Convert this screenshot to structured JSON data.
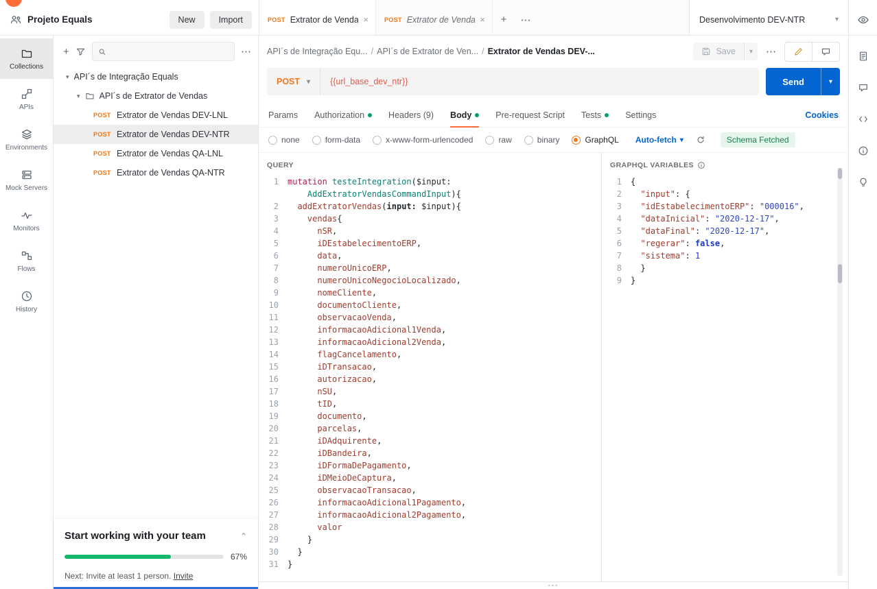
{
  "icons": {
    "plus": "+",
    "more": "⋯",
    "chevron_down": "▾",
    "chevron_up": "⌃",
    "close": "×",
    "slash": "/"
  },
  "colors": {
    "accent_orange": "#ff6c37",
    "method_post": "#f0771a",
    "send_blue": "#0265d2",
    "success_green": "#00a35f",
    "progress_green": "#12b76a",
    "variable_red": "#e05b49"
  },
  "topbar": {
    "workspace": {
      "name": "Projeto Equals",
      "new_label": "New",
      "import_label": "Import"
    },
    "tabs": [
      {
        "method": "POST",
        "title": "Extrator de Vendas DEV",
        "active": true
      },
      {
        "method": "POST",
        "title": "Extrator de Vendas DEV",
        "active": false
      }
    ],
    "environment": {
      "selected": "Desenvolvimento DEV-NTR"
    }
  },
  "icon_rail": {
    "items": [
      {
        "label": "Collections"
      },
      {
        "label": "APIs"
      },
      {
        "label": "Environments"
      },
      {
        "label": "Mock Servers"
      },
      {
        "label": "Monitors"
      },
      {
        "label": "Flows"
      },
      {
        "label": "History"
      }
    ]
  },
  "sidebar": {
    "tree": {
      "root": "API´s de Integração Equals",
      "folder": "API´s de Extrator de Vendas",
      "requests": [
        {
          "method": "POST",
          "name": "Extrator de Vendas DEV-LNL",
          "selected": false
        },
        {
          "method": "POST",
          "name": "Extrator de Vendas DEV-NTR",
          "selected": true
        },
        {
          "method": "POST",
          "name": "Extrator de Vendas QA-LNL",
          "selected": false
        },
        {
          "method": "POST",
          "name": "Extrator de Vendas QA-NTR",
          "selected": false
        }
      ]
    },
    "team_banner": {
      "title": "Start working with your team",
      "progress_percent": "67%",
      "progress_value": 67,
      "next_step": "Next: Invite at least 1 person.",
      "invite_label": "Invite"
    }
  },
  "request": {
    "breadcrumb": [
      "API´s de Integração Equ...",
      "API´s de Extrator de Ven...",
      "Extrator de Vendas DEV-..."
    ],
    "save_label": "Save",
    "method": "POST",
    "url": "{{url_base_dev_ntr}}",
    "send_label": "Send",
    "tabs": [
      {
        "label": "Params",
        "dot": false
      },
      {
        "label": "Authorization",
        "dot": true
      },
      {
        "label": "Headers (9)",
        "dot": false
      },
      {
        "label": "Body",
        "dot": true,
        "active": true
      },
      {
        "label": "Pre-request Script",
        "dot": false
      },
      {
        "label": "Tests",
        "dot": true
      },
      {
        "label": "Settings",
        "dot": false
      }
    ],
    "cookies_label": "Cookies",
    "body_types": [
      "none",
      "form-data",
      "x-www-form-urlencoded",
      "raw",
      "binary",
      "GraphQL"
    ],
    "selected_body_type": "GraphQL",
    "autofetch_label": "Auto-fetch",
    "schema_status": "Schema Fetched"
  },
  "editors": {
    "query": {
      "title": "QUERY",
      "lines": [
        {
          "n": "1",
          "parts": [
            [
              "kw",
              "mutation"
            ],
            [
              "pl",
              " "
            ],
            [
              "fn",
              "testeIntegration"
            ],
            [
              "pl",
              "("
            ],
            [
              "vr",
              "$input"
            ],
            [
              "pl",
              ":\n    "
            ],
            [
              "fn",
              "AddExtratorVendasCommandInput"
            ],
            [
              "pl",
              "){"
            ]
          ]
        },
        {
          "n": "2",
          "parts": [
            [
              "pl",
              "  "
            ],
            [
              "prop",
              "addExtratorVendas"
            ],
            [
              "pl",
              "("
            ],
            [
              "attr",
              "input:"
            ],
            [
              "pl",
              " "
            ],
            [
              "vr",
              "$input"
            ],
            [
              "pl",
              "){"
            ]
          ]
        },
        {
          "n": "3",
          "parts": [
            [
              "pl",
              "    "
            ],
            [
              "prop",
              "vendas"
            ],
            [
              "pl",
              "{"
            ]
          ]
        },
        {
          "n": "4",
          "parts": [
            [
              "pl",
              "      "
            ],
            [
              "prop",
              "nSR"
            ],
            [
              "pl",
              ","
            ]
          ]
        },
        {
          "n": "5",
          "parts": [
            [
              "pl",
              "      "
            ],
            [
              "prop",
              "iDEstabelecimentoERP"
            ],
            [
              "pl",
              ","
            ]
          ]
        },
        {
          "n": "6",
          "parts": [
            [
              "pl",
              "      "
            ],
            [
              "prop",
              "data"
            ],
            [
              "pl",
              ","
            ]
          ]
        },
        {
          "n": "7",
          "parts": [
            [
              "pl",
              "      "
            ],
            [
              "prop",
              "numeroUnicoERP"
            ],
            [
              "pl",
              ","
            ]
          ]
        },
        {
          "n": "8",
          "parts": [
            [
              "pl",
              "      "
            ],
            [
              "prop",
              "numeroUnicoNegocioLocalizado"
            ],
            [
              "pl",
              ","
            ]
          ]
        },
        {
          "n": "9",
          "parts": [
            [
              "pl",
              "      "
            ],
            [
              "prop",
              "nomeCliente"
            ],
            [
              "pl",
              ","
            ]
          ]
        },
        {
          "n": "10",
          "parts": [
            [
              "pl",
              "      "
            ],
            [
              "prop",
              "documentoCliente"
            ],
            [
              "pl",
              ","
            ]
          ]
        },
        {
          "n": "11",
          "parts": [
            [
              "pl",
              "      "
            ],
            [
              "prop",
              "observacaoVenda"
            ],
            [
              "pl",
              ","
            ]
          ]
        },
        {
          "n": "12",
          "parts": [
            [
              "pl",
              "      "
            ],
            [
              "prop",
              "informacaoAdicional1Venda"
            ],
            [
              "pl",
              ","
            ]
          ]
        },
        {
          "n": "13",
          "parts": [
            [
              "pl",
              "      "
            ],
            [
              "prop",
              "informacaoAdicional2Venda"
            ],
            [
              "pl",
              ","
            ]
          ]
        },
        {
          "n": "14",
          "parts": [
            [
              "pl",
              "      "
            ],
            [
              "prop",
              "flagCancelamento"
            ],
            [
              "pl",
              ","
            ]
          ]
        },
        {
          "n": "15",
          "parts": [
            [
              "pl",
              "      "
            ],
            [
              "prop",
              "iDTransacao"
            ],
            [
              "pl",
              ","
            ]
          ]
        },
        {
          "n": "16",
          "parts": [
            [
              "pl",
              "      "
            ],
            [
              "prop",
              "autorizacao"
            ],
            [
              "pl",
              ","
            ]
          ]
        },
        {
          "n": "17",
          "parts": [
            [
              "pl",
              "      "
            ],
            [
              "prop",
              "nSU"
            ],
            [
              "pl",
              ","
            ]
          ]
        },
        {
          "n": "18",
          "parts": [
            [
              "pl",
              "      "
            ],
            [
              "prop",
              "tID"
            ],
            [
              "pl",
              ","
            ]
          ]
        },
        {
          "n": "19",
          "parts": [
            [
              "pl",
              "      "
            ],
            [
              "prop",
              "documento"
            ],
            [
              "pl",
              ","
            ]
          ]
        },
        {
          "n": "20",
          "parts": [
            [
              "pl",
              "      "
            ],
            [
              "prop",
              "parcelas"
            ],
            [
              "pl",
              ","
            ]
          ]
        },
        {
          "n": "21",
          "parts": [
            [
              "pl",
              "      "
            ],
            [
              "prop",
              "iDAdquirente"
            ],
            [
              "pl",
              ","
            ]
          ]
        },
        {
          "n": "22",
          "parts": [
            [
              "pl",
              "      "
            ],
            [
              "prop",
              "iDBandeira"
            ],
            [
              "pl",
              ","
            ]
          ]
        },
        {
          "n": "23",
          "parts": [
            [
              "pl",
              "      "
            ],
            [
              "prop",
              "iDFormaDePagamento"
            ],
            [
              "pl",
              ","
            ]
          ]
        },
        {
          "n": "24",
          "parts": [
            [
              "pl",
              "      "
            ],
            [
              "prop",
              "iDMeioDeCaptura"
            ],
            [
              "pl",
              ","
            ]
          ]
        },
        {
          "n": "25",
          "parts": [
            [
              "pl",
              "      "
            ],
            [
              "prop",
              "observacaoTransacao"
            ],
            [
              "pl",
              ","
            ]
          ]
        },
        {
          "n": "26",
          "parts": [
            [
              "pl",
              "      "
            ],
            [
              "prop",
              "informacaoAdicional1Pagamento"
            ],
            [
              "pl",
              ","
            ]
          ]
        },
        {
          "n": "27",
          "parts": [
            [
              "pl",
              "      "
            ],
            [
              "prop",
              "informacaoAdicional2Pagamento"
            ],
            [
              "pl",
              ","
            ]
          ]
        },
        {
          "n": "28",
          "parts": [
            [
              "pl",
              "      "
            ],
            [
              "prop",
              "valor"
            ]
          ]
        },
        {
          "n": "29",
          "parts": [
            [
              "pl",
              "    }"
            ]
          ]
        },
        {
          "n": "30",
          "parts": [
            [
              "pl",
              "  }"
            ]
          ]
        },
        {
          "n": "31",
          "parts": [
            [
              "pl",
              "}"
            ]
          ]
        }
      ]
    },
    "variables": {
      "title": "GRAPHQL VARIABLES",
      "lines": [
        {
          "n": "1",
          "parts": [
            [
              "pl",
              "{"
            ]
          ]
        },
        {
          "n": "2",
          "parts": [
            [
              "pl",
              "  "
            ],
            [
              "key",
              "\"input\""
            ],
            [
              "pl",
              ": {"
            ]
          ]
        },
        {
          "n": "3",
          "parts": [
            [
              "pl",
              "  "
            ],
            [
              "key",
              "\"idEstabelecimentoERP\""
            ],
            [
              "pl",
              ": "
            ],
            [
              "str",
              "\"000016\""
            ],
            [
              "pl",
              ","
            ]
          ]
        },
        {
          "n": "4",
          "parts": [
            [
              "pl",
              "  "
            ],
            [
              "key",
              "\"dataInicial\""
            ],
            [
              "pl",
              ": "
            ],
            [
              "str",
              "\"2020-12-17\""
            ],
            [
              "pl",
              ","
            ]
          ]
        },
        {
          "n": "5",
          "parts": [
            [
              "pl",
              "  "
            ],
            [
              "key",
              "\"dataFinal\""
            ],
            [
              "pl",
              ": "
            ],
            [
              "str",
              "\"2020-12-17\""
            ],
            [
              "pl",
              ","
            ]
          ]
        },
        {
          "n": "6",
          "parts": [
            [
              "pl",
              "  "
            ],
            [
              "key",
              "\"regerar\""
            ],
            [
              "pl",
              ": "
            ],
            [
              "bool",
              "false"
            ],
            [
              "pl",
              ","
            ]
          ]
        },
        {
          "n": "7",
          "parts": [
            [
              "pl",
              "  "
            ],
            [
              "key",
              "\"sistema\""
            ],
            [
              "pl",
              ": "
            ],
            [
              "num",
              "1"
            ]
          ]
        },
        {
          "n": "8",
          "parts": [
            [
              "pl",
              "  }"
            ]
          ]
        },
        {
          "n": "9",
          "parts": [
            [
              "pl",
              "}"
            ]
          ]
        }
      ]
    }
  }
}
